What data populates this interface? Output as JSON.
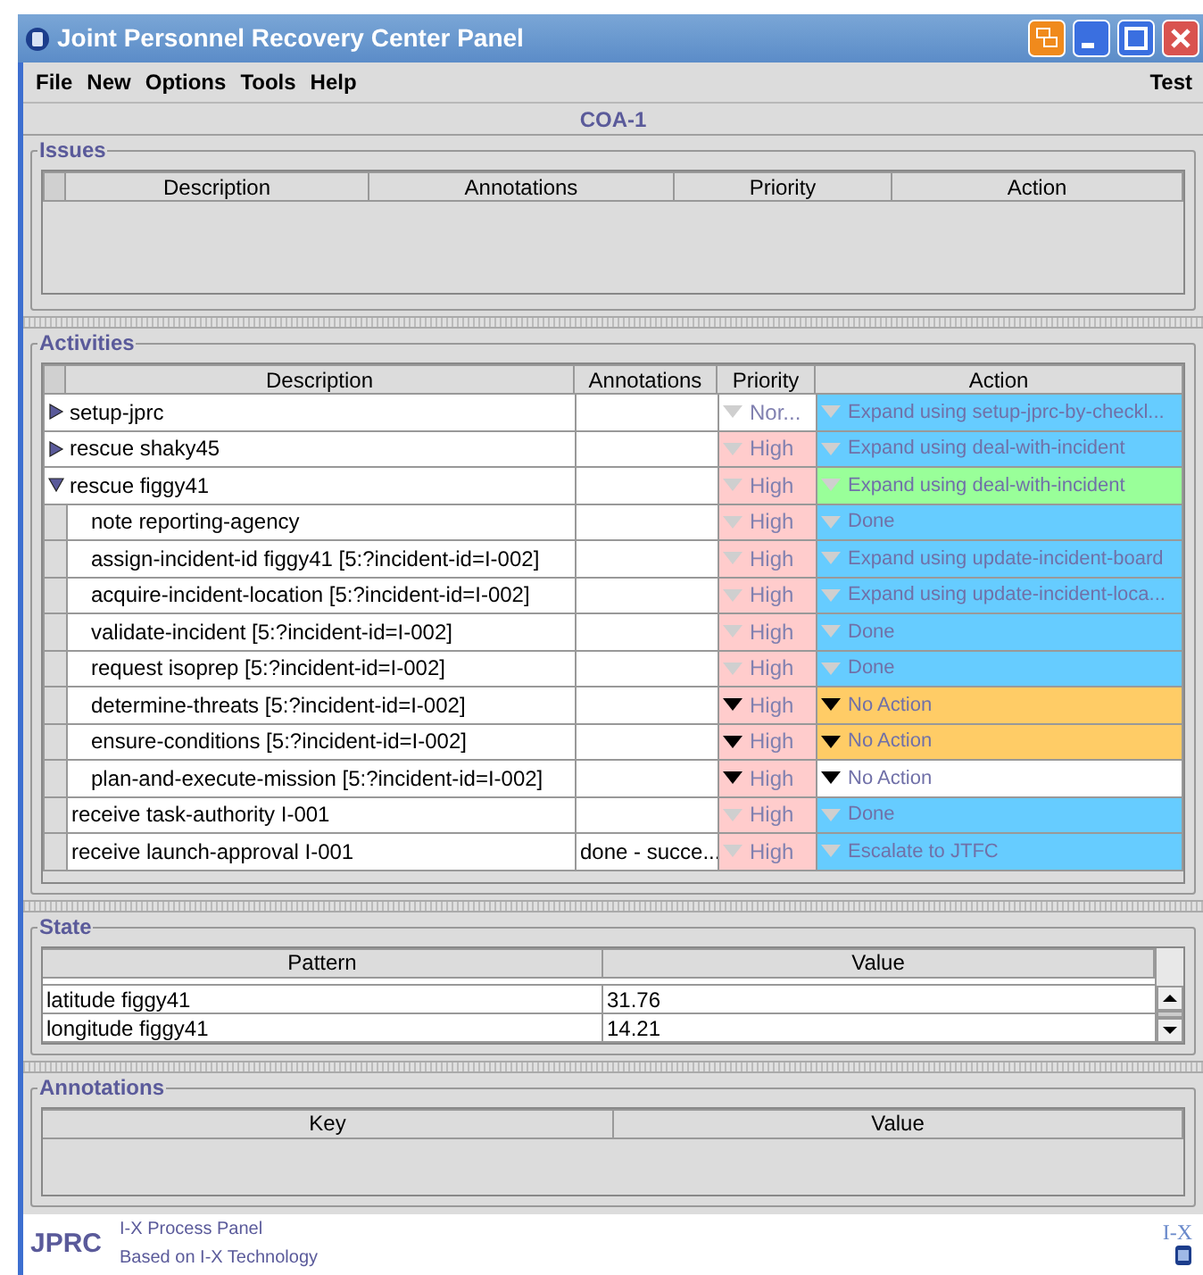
{
  "window": {
    "title": "Joint Personnel Recovery Center Panel"
  },
  "menu": [
    {
      "label": "File"
    },
    {
      "label": "New"
    },
    {
      "label": "Options"
    },
    {
      "label": "Tools"
    },
    {
      "label": "Help"
    }
  ],
  "menu_right": "Test",
  "plan_title": "COA-1",
  "issues": {
    "title": "Issues",
    "columns": [
      "Description",
      "Annotations",
      "Priority",
      "Action"
    ]
  },
  "activities": {
    "title": "Activities",
    "columns": [
      "Description",
      "Annotations",
      "Priority",
      "Action"
    ],
    "rows": [
      {
        "description": "setup-jprc",
        "expanded": false,
        "priority": {
          "text": "Nor...",
          "color": "#ffffff",
          "active": false
        },
        "action": {
          "text": "Expand using setup-jprc-by-checkl...",
          "color": "#66ccff",
          "active": false
        },
        "children": []
      },
      {
        "description": "rescue shaky45",
        "expanded": false,
        "priority": {
          "text": "High",
          "color": "#ffcccc",
          "active": false
        },
        "action": {
          "text": "Expand using deal-with-incident",
          "color": "#66ccff",
          "active": false
        },
        "children": []
      },
      {
        "description": "rescue figgy41",
        "expanded": true,
        "priority": {
          "text": "High",
          "color": "#ffcccc",
          "active": false
        },
        "action": {
          "text": "Expand using deal-with-incident",
          "color": "#99ff99",
          "active": false
        },
        "children": [
          {
            "description": "note reporting-agency",
            "priority": {
              "text": "High",
              "color": "#ffcccc",
              "active": false
            },
            "action": {
              "text": "Done",
              "color": "#66ccff",
              "active": false
            }
          },
          {
            "description": "assign-incident-id figgy41 [5:?incident-id=I-002]",
            "priority": {
              "text": "High",
              "color": "#ffcccc",
              "active": false
            },
            "action": {
              "text": "Expand using update-incident-board",
              "color": "#66ccff",
              "active": false
            }
          },
          {
            "description": "acquire-incident-location [5:?incident-id=I-002]",
            "priority": {
              "text": "High",
              "color": "#ffcccc",
              "active": false
            },
            "action": {
              "text": "Expand using update-incident-loca...",
              "color": "#66ccff",
              "active": false
            }
          },
          {
            "description": "validate-incident [5:?incident-id=I-002]",
            "priority": {
              "text": "High",
              "color": "#ffcccc",
              "active": false
            },
            "action": {
              "text": "Done",
              "color": "#66ccff",
              "active": false
            }
          },
          {
            "description": "request isoprep [5:?incident-id=I-002]",
            "priority": {
              "text": "High",
              "color": "#ffcccc",
              "active": false
            },
            "action": {
              "text": "Done",
              "color": "#66ccff",
              "active": false
            }
          },
          {
            "description": "determine-threats [5:?incident-id=I-002]",
            "priority": {
              "text": "High",
              "color": "#ffcccc",
              "active": true
            },
            "action": {
              "text": "No Action",
              "color": "#ffcc66",
              "active": true
            }
          },
          {
            "description": "ensure-conditions [5:?incident-id=I-002]",
            "priority": {
              "text": "High",
              "color": "#ffcccc",
              "active": true
            },
            "action": {
              "text": "No Action",
              "color": "#ffcc66",
              "active": true
            }
          },
          {
            "description": "plan-and-execute-mission [5:?incident-id=I-002]",
            "priority": {
              "text": "High",
              "color": "#ffcccc",
              "active": true
            },
            "action": {
              "text": "No Action",
              "color": "#ffffff",
              "active": true
            }
          }
        ]
      },
      {
        "description": "receive task-authority I-001",
        "priority": {
          "text": "High",
          "color": "#ffcccc",
          "active": false
        },
        "action": {
          "text": "Done",
          "color": "#66ccff",
          "active": false
        }
      },
      {
        "description": "receive launch-approval I-001",
        "annotations": "done - succe...",
        "priority": {
          "text": "High",
          "color": "#ffcccc",
          "active": false
        },
        "action": {
          "text": "Escalate to JTFC",
          "color": "#66ccff",
          "active": false
        }
      }
    ]
  },
  "state": {
    "title": "State",
    "columns": [
      "Pattern",
      "Value"
    ],
    "rows": [
      {
        "pattern": "latitude figgy41",
        "value": "31.76"
      },
      {
        "pattern": "longitude figgy41",
        "value": "14.21"
      }
    ]
  },
  "annotations": {
    "title": "Annotations",
    "columns": [
      "Key",
      "Value"
    ]
  },
  "footer": {
    "logo": "JPRC",
    "line_1": "I-X Process Panel",
    "line_2": "Based on I-X Technology",
    "mark": "I-X"
  }
}
